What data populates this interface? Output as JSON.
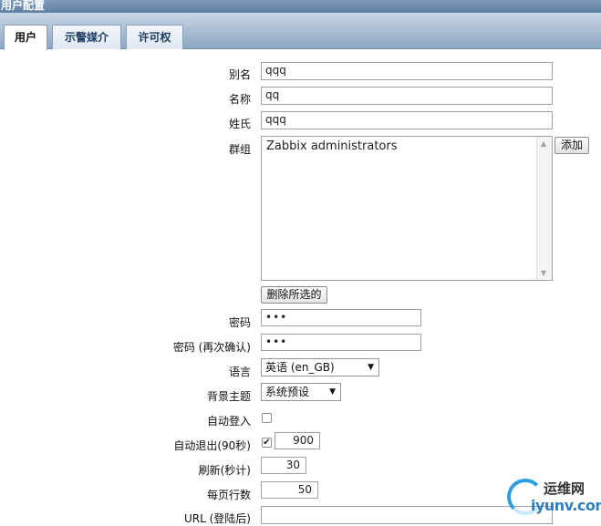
{
  "window": {
    "title": "用户配置"
  },
  "tabs": [
    {
      "label": "用户",
      "active": true
    },
    {
      "label": "示警媒介",
      "active": false
    },
    {
      "label": "许可权",
      "active": false
    }
  ],
  "form": {
    "alias": {
      "label": "别名",
      "value": "qqq"
    },
    "name": {
      "label": "名称",
      "value": "qq"
    },
    "surname": {
      "label": "姓氏",
      "value": "qqq"
    },
    "groups": {
      "label": "群组",
      "items": [
        "Zabbix administrators"
      ],
      "add_label": "添加",
      "remove_label": "删除所选的"
    },
    "password": {
      "label": "密码",
      "value": "•••"
    },
    "password_confirm": {
      "label": "密码 (再次确认)",
      "value": "•••"
    },
    "language": {
      "label": "语言",
      "selected": "英语 (en_GB)"
    },
    "theme": {
      "label": "背景主题",
      "selected": "系统预设"
    },
    "autologin": {
      "label": "自动登入",
      "checked": false
    },
    "autologout": {
      "label": "自动退出(90秒)",
      "checked": true,
      "value": "900"
    },
    "refresh": {
      "label": "刷新(秒计)",
      "value": "30"
    },
    "rows_per_page": {
      "label": "每页行数",
      "value": "50"
    },
    "url": {
      "label": "URL (登陆后)",
      "value": ""
    }
  },
  "watermark": {
    "brand_cn": "运维网",
    "brand_en": "iyunv.com"
  },
  "colors": {
    "accent": "#5e7fa3",
    "logo_blue": "#2d9ee0"
  }
}
